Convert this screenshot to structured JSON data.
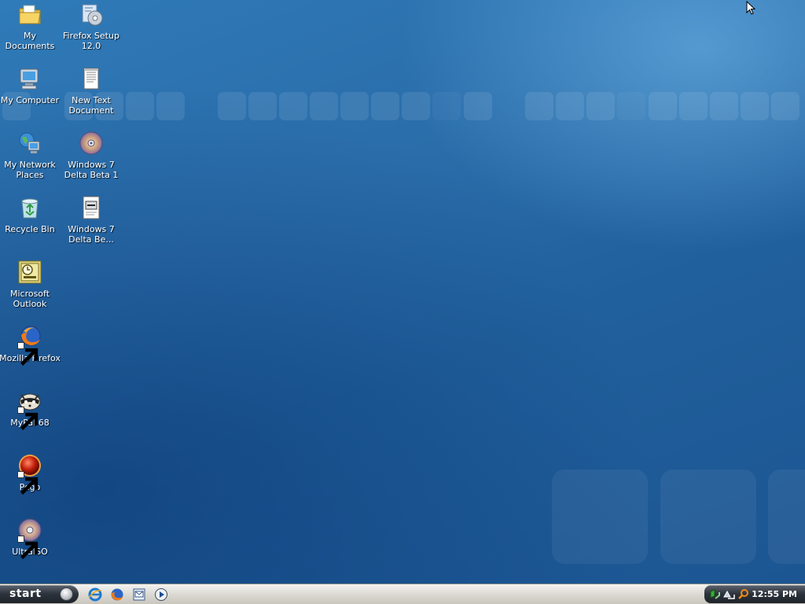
{
  "desktop": {
    "icons": [
      {
        "label": "My Documents",
        "icon": "folder-documents-icon"
      },
      {
        "label": "Firefox Setup\n12.0",
        "icon": "installer-icon"
      },
      {
        "label": "My Computer",
        "icon": "computer-icon"
      },
      {
        "label": "New Text\nDocument",
        "icon": "text-document-icon"
      },
      {
        "label": "My Network\nPlaces",
        "icon": "network-icon"
      },
      {
        "label": "Windows 7\nDelta Beta 1",
        "icon": "disc-image-icon"
      },
      {
        "label": "Recycle Bin",
        "icon": "recycle-bin-icon"
      },
      {
        "label": "Windows 7\nDelta Be...",
        "icon": "setup-file-icon"
      },
      {
        "label": "Microsoft\nOutlook",
        "icon": "outlook-icon"
      },
      {
        "label": "Mozilla Firefox",
        "icon": "firefox-icon"
      },
      {
        "label": "MyPal 68",
        "icon": "mypal-icon"
      },
      {
        "label": "Pego",
        "icon": "pego-icon"
      },
      {
        "label": "UltraISO",
        "icon": "ultraiso-icon"
      }
    ]
  },
  "taskbar": {
    "start_label": "start",
    "quick_launch": [
      "internet-explorer-icon",
      "firefox-icon",
      "outlook-express-icon",
      "media-player-icon"
    ],
    "tray_icons": [
      "network-status-icon",
      "network-activity-icon",
      "search-icon"
    ],
    "clock": "12:55 PM"
  },
  "colors": {
    "desktop_blue": "#2a6daa",
    "taskbar_silver": "#dedcd6",
    "start_dark": "#2c323b"
  }
}
